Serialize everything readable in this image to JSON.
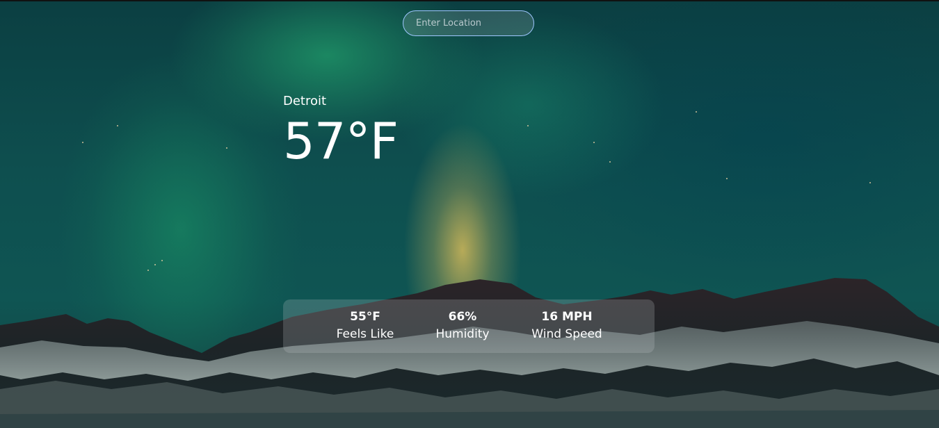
{
  "search": {
    "placeholder": "Enter Location"
  },
  "location": {
    "city": "Detroit"
  },
  "current": {
    "temperature": "57°F"
  },
  "details": [
    {
      "value": "55°F",
      "label": "Feels Like"
    },
    {
      "value": "66%",
      "label": "Humidity"
    },
    {
      "value": "16 MPH",
      "label": "Wind Speed"
    }
  ],
  "colors": {
    "sky_top": "#0b3f42",
    "sky_mid": "#0f5553",
    "aurora_green": "#28be78",
    "aurora_glow": "#f0c85a",
    "input_border": "#9fc6ff",
    "text": "#ffffff"
  }
}
